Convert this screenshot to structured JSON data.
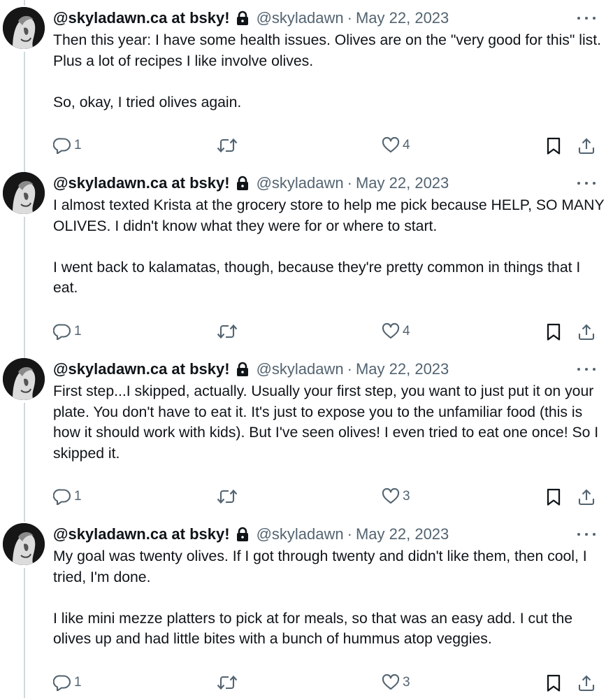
{
  "tweets": [
    {
      "display_name": "@skyladawn.ca at bsky!",
      "handle": "@skyladawn",
      "separator": "·",
      "date": "May 22, 2023",
      "text": "Then this year: I have some health issues. Olives are on the \"very good for this\" list. Plus a lot of recipes I like involve olives.\n\nSo, okay, I tried olives again.",
      "replies": "1",
      "retweets": "",
      "likes": "4"
    },
    {
      "display_name": "@skyladawn.ca at bsky!",
      "handle": "@skyladawn",
      "separator": "·",
      "date": "May 22, 2023",
      "text": "I almost texted Krista at the grocery store to help me pick because HELP, SO MANY OLIVES. I didn't know what they were for or where to start.\n\nI went back to kalamatas, though, because they're pretty common in things that I eat.",
      "replies": "1",
      "retweets": "",
      "likes": "4"
    },
    {
      "display_name": "@skyladawn.ca at bsky!",
      "handle": "@skyladawn",
      "separator": "·",
      "date": "May 22, 2023",
      "text": "First step...I skipped, actually. Usually your first step, you want to just put it on your plate. You don't have to eat it. It's just to expose you to the unfamiliar food (this is how it should work with kids). But I've seen olives! I even tried to eat one once! So I skipped it.",
      "replies": "1",
      "retweets": "",
      "likes": "3"
    },
    {
      "display_name": "@skyladawn.ca at bsky!",
      "handle": "@skyladawn",
      "separator": "·",
      "date": "May 22, 2023",
      "text": "My goal was twenty olives. If I got through twenty and didn't like them, then cool, I tried, I'm done.\n\nI like mini mezze platters to pick at for meals, so that was an easy add. I cut the olives up and had little bites with a bunch of hummus atop veggies.",
      "replies": "1",
      "retweets": "",
      "likes": "3"
    }
  ],
  "icons": {
    "verified_lock": "lock-icon",
    "more": "more-icon",
    "reply": "reply-icon",
    "retweet": "retweet-icon",
    "like": "heart-icon",
    "bookmark": "bookmark-icon",
    "share": "share-icon"
  },
  "colors": {
    "text": "#0f1419",
    "secondary": "#536471",
    "thread_line": "#cfd9de"
  }
}
